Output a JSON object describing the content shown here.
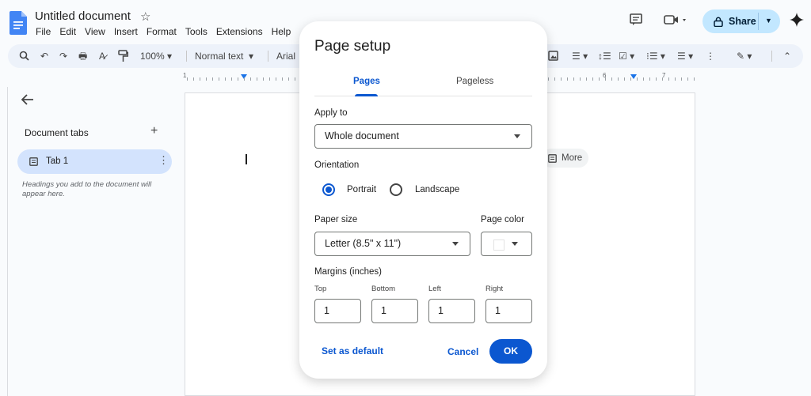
{
  "header": {
    "doc_title": "Untitled document",
    "menu": [
      "File",
      "Edit",
      "View",
      "Insert",
      "Format",
      "Tools",
      "Extensions",
      "Help"
    ],
    "share_label": "Share"
  },
  "toolbar": {
    "zoom": "100%",
    "style": "Normal text",
    "font": "Arial"
  },
  "ruler": {
    "numbers": [
      "1",
      "6",
      "7"
    ]
  },
  "side_panel": {
    "title": "Document tabs",
    "tab_label": "Tab 1",
    "hint": "Headings you add to the document will appear here."
  },
  "page": {
    "more_label": "More"
  },
  "dialog": {
    "title": "Page setup",
    "tabs": {
      "pages": "Pages",
      "pageless": "Pageless"
    },
    "apply_to": {
      "label": "Apply to",
      "value": "Whole document"
    },
    "orientation": {
      "label": "Orientation",
      "portrait": "Portrait",
      "landscape": "Landscape",
      "selected": "Portrait"
    },
    "paper_size": {
      "label": "Paper size",
      "value": "Letter (8.5\" x 11\")"
    },
    "page_color": {
      "label": "Page color",
      "value": "#ffffff"
    },
    "margins": {
      "label": "Margins (inches)",
      "top_label": "Top",
      "top": "1",
      "bottom_label": "Bottom",
      "bottom": "1",
      "left_label": "Left",
      "left": "1",
      "right_label": "Right",
      "right": "1"
    },
    "set_default": "Set as default",
    "cancel": "Cancel",
    "ok": "OK"
  },
  "colors": {
    "accent": "#0b57d0",
    "share_bg": "#c2e7ff",
    "toolbar_bg": "#edf2fa",
    "tab_active_bg": "#d3e3fd"
  }
}
